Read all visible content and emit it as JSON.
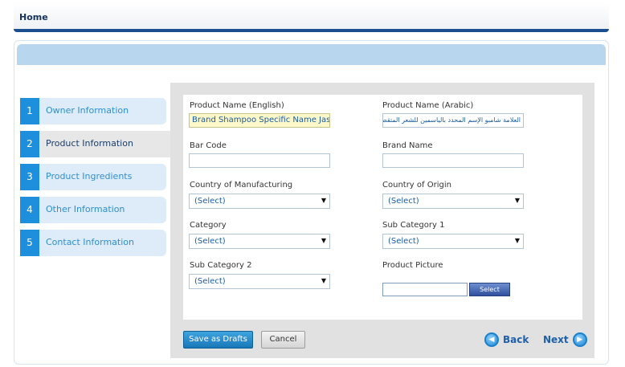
{
  "header": {
    "home_label": "Home"
  },
  "steps": [
    {
      "num": "1",
      "label": "Owner Information"
    },
    {
      "num": "2",
      "label": "Product Information"
    },
    {
      "num": "3",
      "label": "Product Ingredients"
    },
    {
      "num": "4",
      "label": "Other Information"
    },
    {
      "num": "5",
      "label": "Contact Information"
    }
  ],
  "form": {
    "name_en_label": "Product Name (English)",
    "name_en_value": "Brand Shampoo Specific Name Jasm",
    "name_ar_label": "Product Name (Arabic)",
    "name_ar_value": "العلامة شامبو الإسم المحدد بالياسمين للشعر المتقصف",
    "barcode_label": "Bar Code",
    "barcode_value": "",
    "brand_label": "Brand Name",
    "brand_value": "",
    "country_mfg_label": "Country of Manufacturing",
    "country_mfg_value": "(Select)",
    "country_origin_label": "Country of Origin",
    "country_origin_value": "(Select)",
    "category_label": "Category",
    "category_value": "(Select)",
    "subcat1_label": "Sub Category 1",
    "subcat1_value": "(Select)",
    "subcat2_label": "Sub Category 2",
    "subcat2_value": "(Select)",
    "picture_label": "Product Picture",
    "picture_button": "Select"
  },
  "actions": {
    "save_drafts": "Save as Drafts",
    "cancel": "Cancel",
    "back": "Back",
    "next": "Next"
  },
  "icons": {
    "back": "back-arrow-icon",
    "next": "next-arrow-icon",
    "dropdown": "chevron-down-icon"
  },
  "colors": {
    "accent": "#1e8fdd",
    "header_rule": "#1b4e8e",
    "panel_band": "#b8d7ef",
    "highlight_input": "#fcf8c9"
  }
}
